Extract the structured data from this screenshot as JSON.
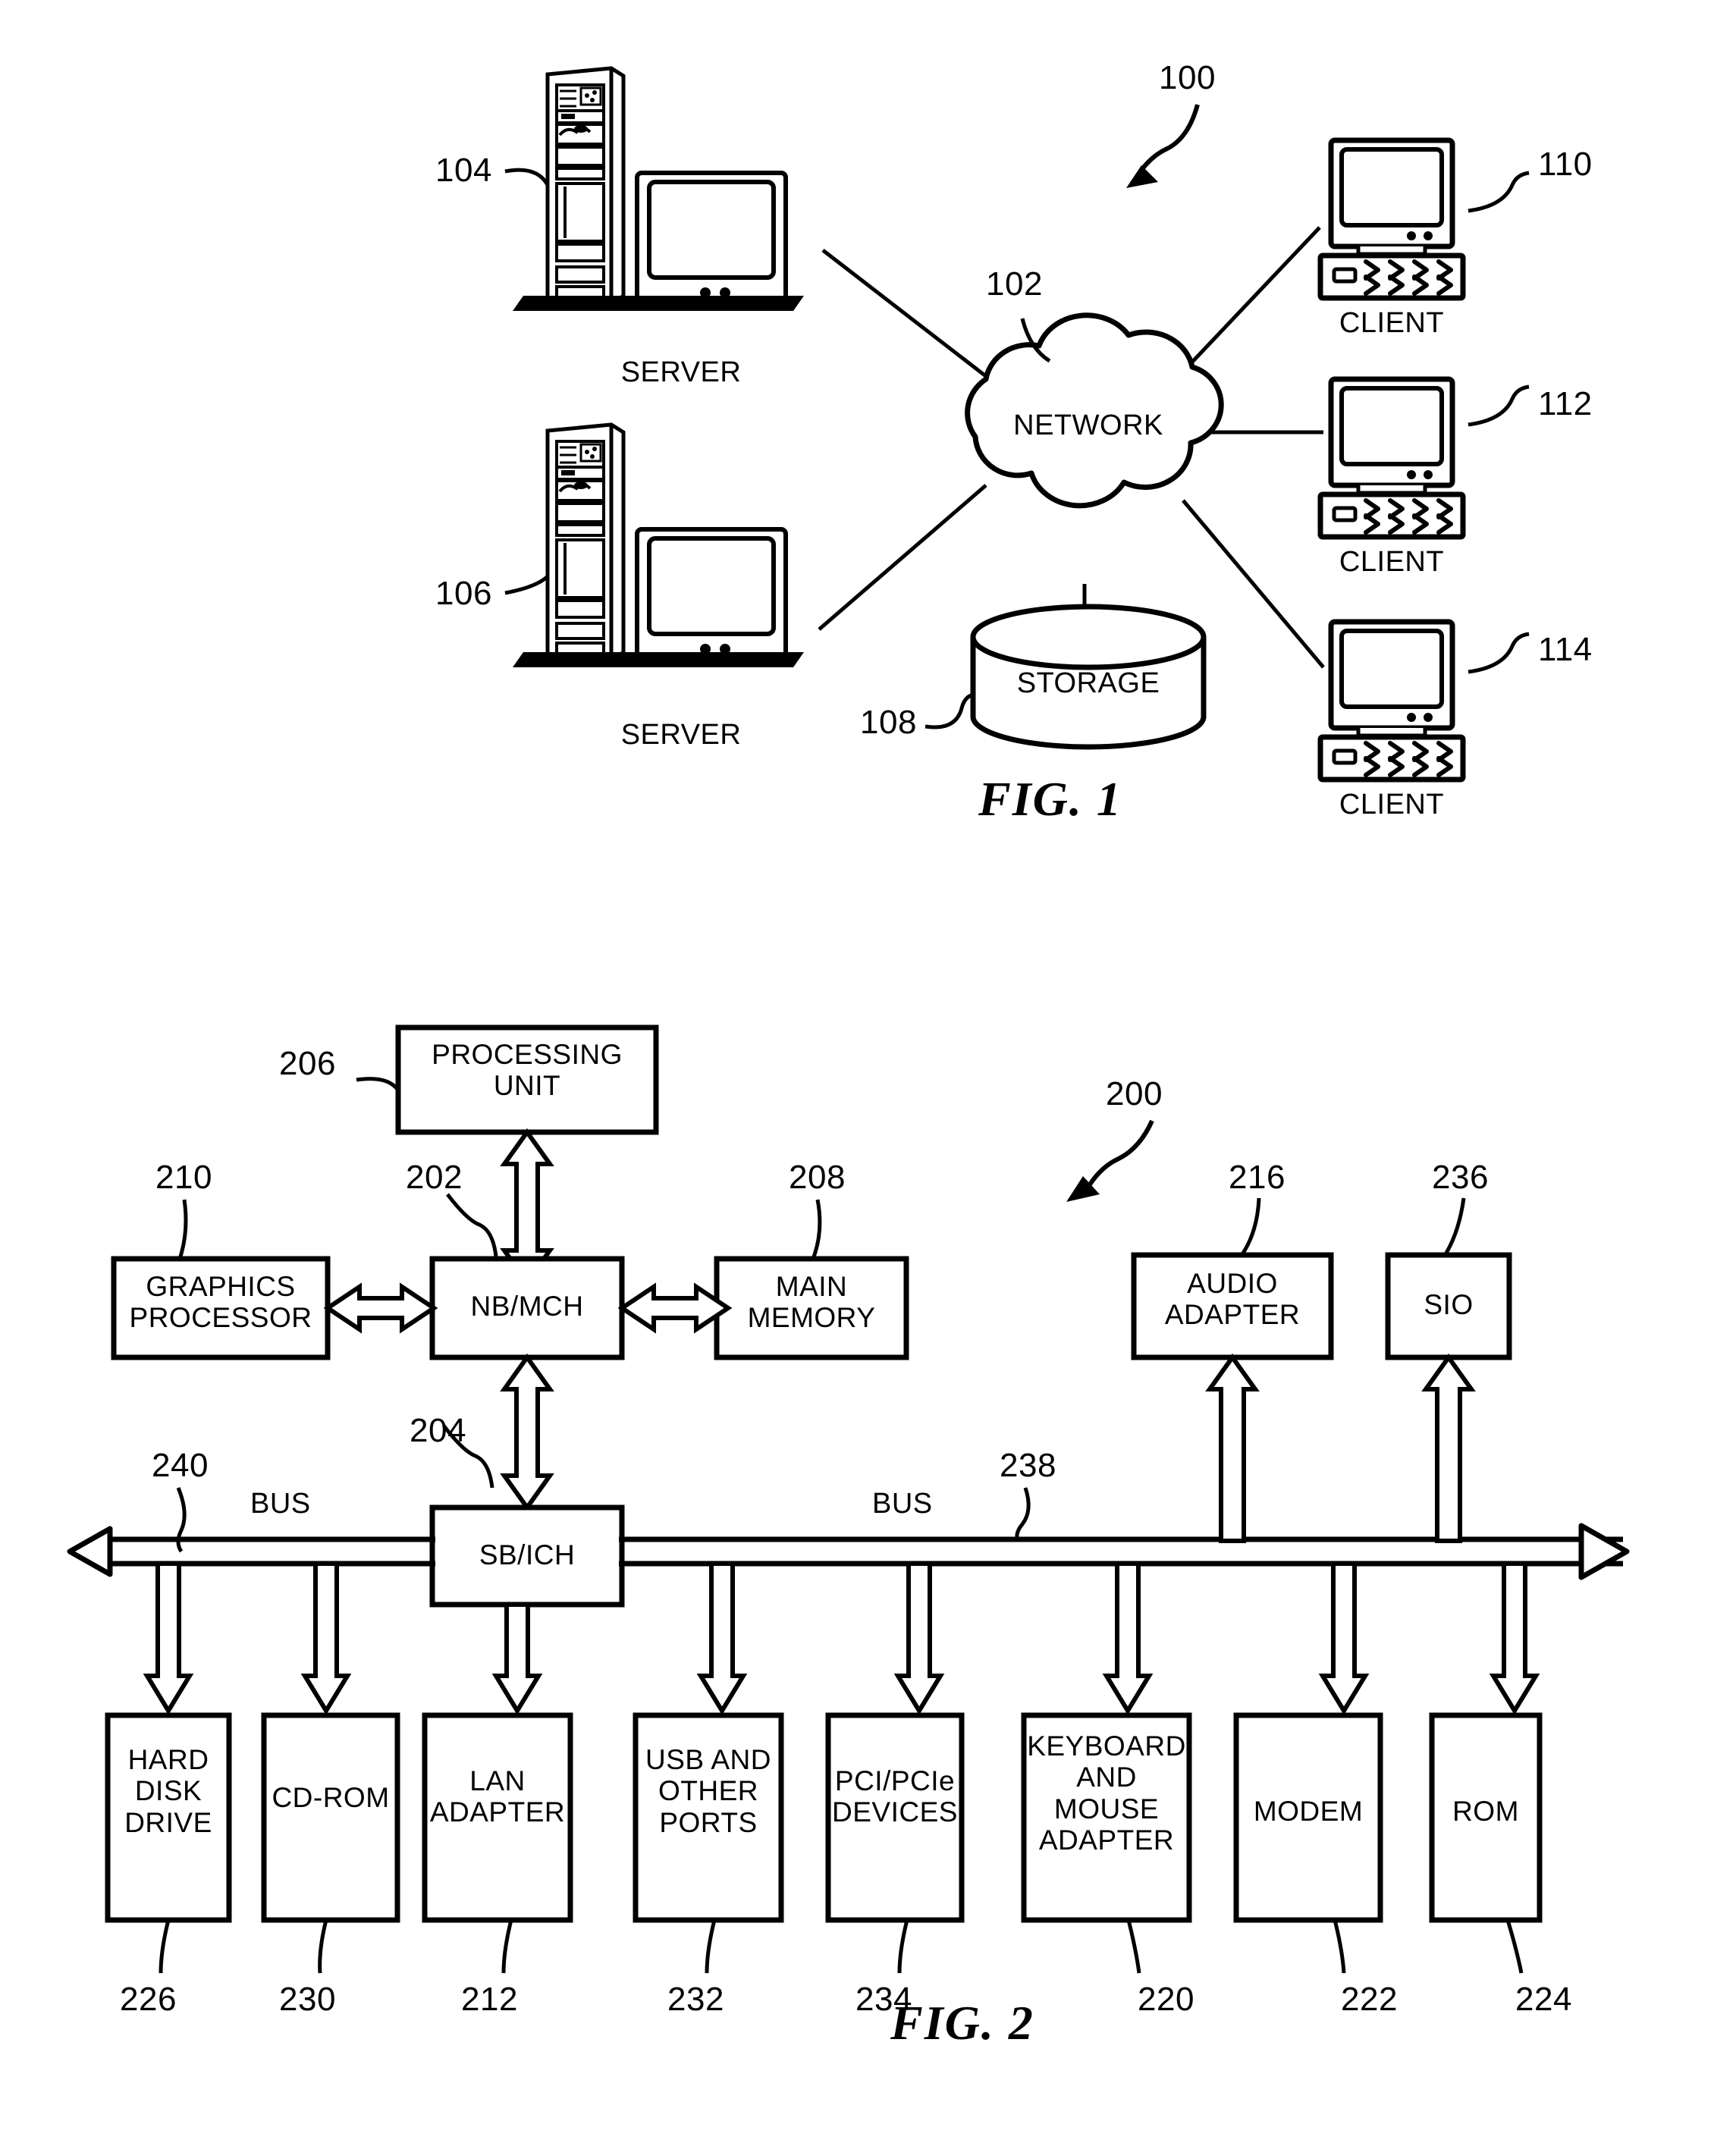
{
  "figures": [
    {
      "id": "fig1",
      "caption": "FIG. 1",
      "system_ref": "100",
      "nodes": {
        "server_top": {
          "label": "SERVER",
          "ref": "104"
        },
        "server_bottom": {
          "label": "SERVER",
          "ref": "106"
        },
        "network": {
          "label": "NETWORK",
          "ref": "102"
        },
        "storage": {
          "label": "STORAGE",
          "ref": "108"
        },
        "client_1": {
          "label": "CLIENT",
          "ref": "110"
        },
        "client_2": {
          "label": "CLIENT",
          "ref": "112"
        },
        "client_3": {
          "label": "CLIENT",
          "ref": "114"
        }
      }
    },
    {
      "id": "fig2",
      "caption": "FIG. 2",
      "system_ref": "200",
      "bus_labels": {
        "left": "BUS",
        "right": "BUS",
        "left_ref": "240",
        "right_ref": "238"
      },
      "nodes": {
        "processing_unit": {
          "label": "PROCESSING\nUNIT",
          "ref": "206"
        },
        "nb_mch": {
          "label": "NB/MCH",
          "ref": "202"
        },
        "graphics_processor": {
          "label": "GRAPHICS\nPROCESSOR",
          "ref": "210"
        },
        "main_memory": {
          "label": "MAIN\nMEMORY",
          "ref": "208"
        },
        "audio_adapter": {
          "label": "AUDIO\nADAPTER",
          "ref": "216"
        },
        "sio": {
          "label": "SIO",
          "ref": "236"
        },
        "sb_ich": {
          "label": "SB/ICH",
          "ref": "204"
        },
        "hard_disk_drive": {
          "label": "HARD\nDISK\nDRIVE",
          "ref": "226"
        },
        "cd_rom": {
          "label": "CD-ROM",
          "ref": "230"
        },
        "lan_adapter": {
          "label": "LAN\nADAPTER",
          "ref": "212"
        },
        "usb_other_ports": {
          "label": "USB AND\nOTHER\nPORTS",
          "ref": "232"
        },
        "pci_pcie_devices": {
          "label": "PCI/PCIe\nDEVICES",
          "ref": "234"
        },
        "keyboard_mouse_adapter": {
          "label": "KEYBOARD\nAND\nMOUSE\nADAPTER",
          "ref": "220"
        },
        "modem": {
          "label": "MODEM",
          "ref": "222"
        },
        "rom": {
          "label": "ROM",
          "ref": "224"
        }
      }
    }
  ],
  "colors": {
    "ink": "#000000",
    "paper": "#ffffff"
  }
}
